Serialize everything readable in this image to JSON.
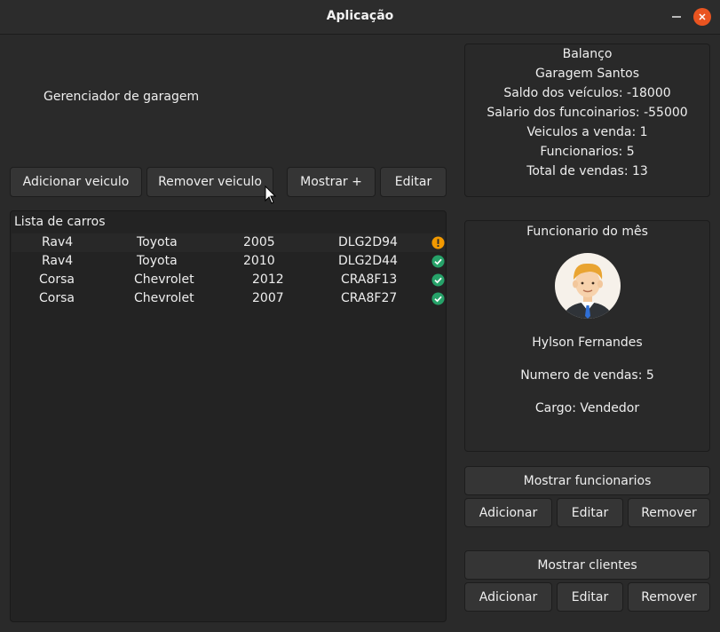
{
  "window": {
    "title": "Aplicação"
  },
  "header": {
    "app_label": "Gerenciador de garagem"
  },
  "toolbar": {
    "add_vehicle": "Adicionar veiculo",
    "remove_vehicle": "Remover veiculo",
    "show_more": "Mostrar +",
    "edit": "Editar"
  },
  "car_list": {
    "title": "Lista de carros",
    "rows": [
      {
        "model": "Rav4",
        "brand": "Toyota",
        "year": "2005",
        "plate": "DLG2D94",
        "status": "warning-icon",
        "status_color": "#f29900"
      },
      {
        "model": "Rav4",
        "brand": "Toyota",
        "year": "2010",
        "plate": "DLG2D44",
        "status": "check-icon",
        "status_color": "#26a269"
      },
      {
        "model": "Corsa",
        "brand": "Chevrolet",
        "year": "2012",
        "plate": "CRA8F13",
        "status": "check-icon",
        "status_color": "#26a269"
      },
      {
        "model": "Corsa",
        "brand": "Chevrolet",
        "year": "2007",
        "plate": "CRA8F27",
        "status": "check-icon",
        "status_color": "#26a269"
      }
    ]
  },
  "balance": {
    "title": "Balanço",
    "garage_name": "Garagem Santos",
    "vehicles_balance": "Saldo dos veículos: -18000",
    "employees_salary": "Salario dos funcoinarios: -55000",
    "vehicles_for_sale": "Veiculos a venda: 1",
    "employees": "Funcionarios: 5",
    "total_sales": "Total de vendas:  13"
  },
  "employee_of_month": {
    "title": "Funcionario do mês",
    "name": "Hylson Fernandes",
    "sales": "Numero de vendas: 5",
    "role": "Cargo: Vendedor"
  },
  "employees_section": {
    "show_label": "Mostrar funcionarios",
    "add_label": "Adicionar",
    "edit_label": "Editar",
    "remove_label": "Remover"
  },
  "clients_section": {
    "show_label": "Mostrar clientes",
    "add_label": "Adicionar",
    "edit_label": "Editar",
    "remove_label": "Remover"
  },
  "colors": {
    "accent_close": "#e95420",
    "warning": "#f29900",
    "ok": "#26a269"
  }
}
